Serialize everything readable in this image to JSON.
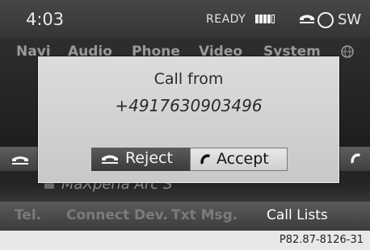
{
  "status_bar": {
    "time": "4:03",
    "status_text": "READY",
    "signal_bars": 5,
    "signal_filled": 4,
    "compass_direction": "SW",
    "icons": [
      "phone-handset-icon",
      "compass-icon"
    ]
  },
  "main_tabs": {
    "items": [
      "Navi",
      "Audio",
      "Phone",
      "Video",
      "System"
    ],
    "icon": "globe-icon"
  },
  "contact": {
    "label": "MaXperia Arc S"
  },
  "bottom_menu": {
    "items": [
      "Tel.",
      "Connect Dev.",
      "Txt Msg.",
      "Call Lists"
    ],
    "active": "Call Lists"
  },
  "dialog": {
    "title": "Call from",
    "number": "+4917630903496",
    "reject_label": "Reject",
    "accept_label": "Accept"
  },
  "figure_code": "P82.87-8126-31",
  "colors": {
    "status_bg": "#3d3d3d",
    "dialog_bg": "#d6d6d6",
    "reject_bg": "#4a4a4a",
    "accept_bg": "#dedede"
  }
}
